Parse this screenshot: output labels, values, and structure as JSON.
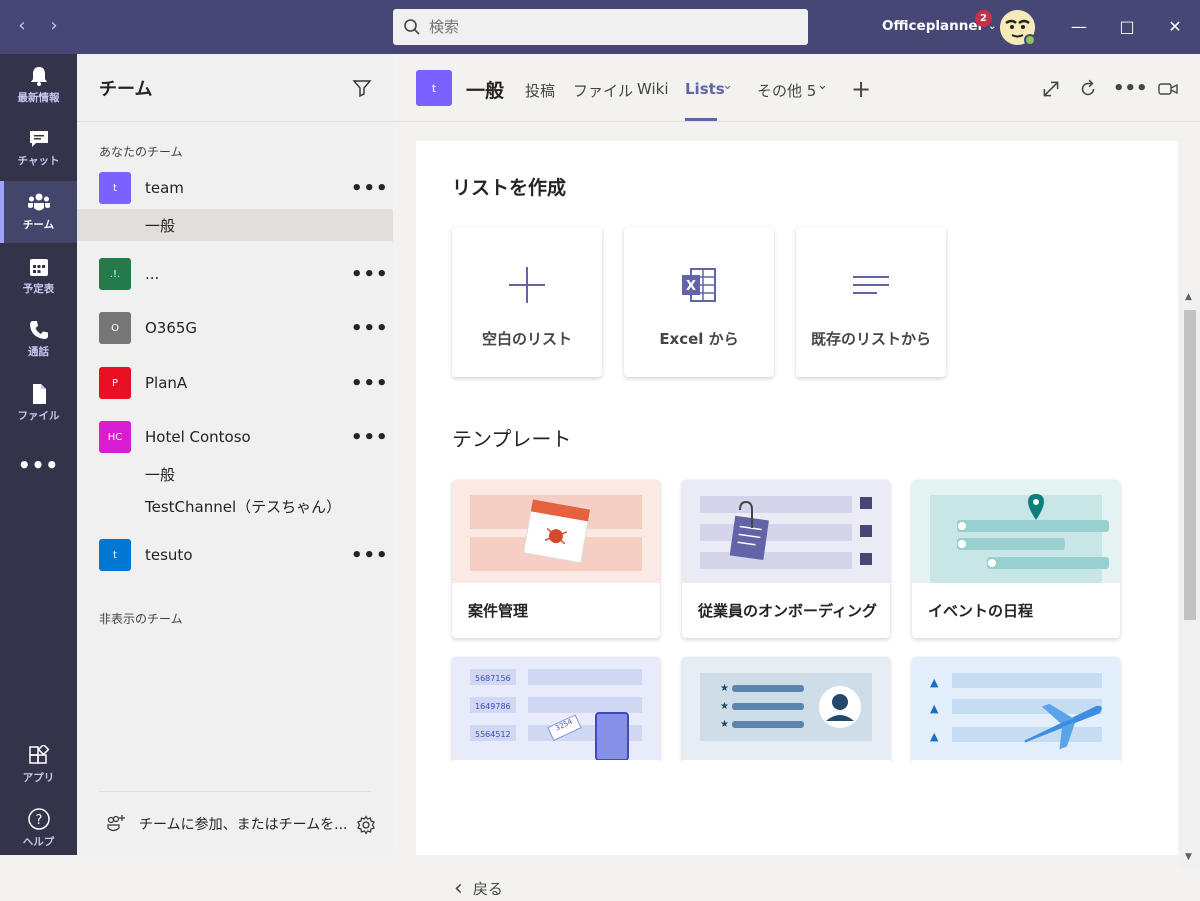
{
  "search": {
    "placeholder": "検索"
  },
  "user": {
    "name": "Officeplanner",
    "badge": "2"
  },
  "rail": [
    {
      "label": "最新情報"
    },
    {
      "label": "チャット"
    },
    {
      "label": "チーム"
    },
    {
      "label": "予定表"
    },
    {
      "label": "通話"
    },
    {
      "label": "ファイル"
    },
    {
      "label": "アプリ"
    },
    {
      "label": "ヘルプ"
    }
  ],
  "teams": {
    "title": "チーム",
    "your_teams": "あなたのチーム",
    "list": [
      {
        "icon": "t",
        "name": "team",
        "color": "#7b61ff"
      },
      {
        "icon": ".!.",
        "name": "...",
        "color": "#237b4b"
      },
      {
        "icon": "O",
        "name": "O365G",
        "color": "#767676"
      },
      {
        "icon": "P",
        "name": "PlanA",
        "color": "#e81123"
      },
      {
        "icon": "HC",
        "name": "Hotel Contoso",
        "color": "#d81cd0"
      },
      {
        "icon": "t",
        "name": "tesuto",
        "color": "#0078d4"
      }
    ],
    "channels": {
      "team_general": "一般",
      "hc_general": "一般",
      "hc_test": "TestChannel（テスちゃん）"
    },
    "hidden": "非表示のチーム",
    "join": "チームに参加、またはチームを..."
  },
  "channel": {
    "icon": "t",
    "title": "一般",
    "tabs": [
      "投稿",
      "ファイル",
      "Wiki",
      "Lists",
      "その他 5"
    ]
  },
  "lists": {
    "create_heading": "リストを作成",
    "create": [
      "空白のリスト",
      "Excel から",
      "既存のリストから"
    ],
    "templates_heading": "テンプレート",
    "templates": [
      "案件管理",
      "従業員のオンボーディング",
      "イベントの日程",
      "",
      "",
      ""
    ],
    "asset_numbers": [
      "5687156",
      "1649786",
      "5564512"
    ],
    "tag_number": "3254",
    "back": "戻る"
  },
  "colors": {
    "accent": "#6264a7",
    "titlebar": "#464775",
    "rail": "#33344a"
  }
}
